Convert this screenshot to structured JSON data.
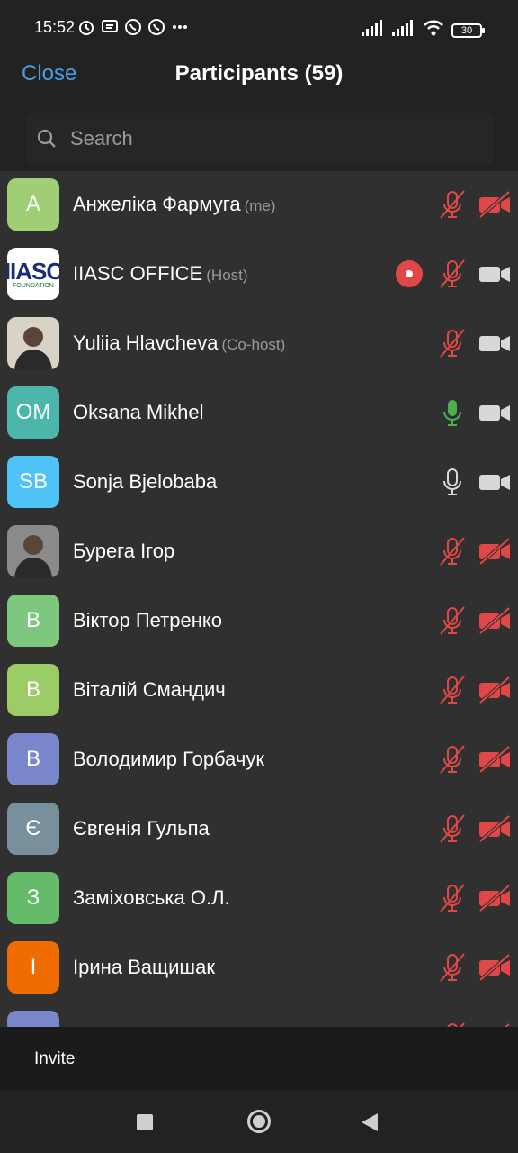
{
  "status_bar": {
    "time": "15:52",
    "battery": "30"
  },
  "header": {
    "close_label": "Close",
    "title": "Participants (59)"
  },
  "search": {
    "placeholder": "Search"
  },
  "participants": [
    {
      "initials": "A",
      "name": "Анжеліка Фармуга",
      "role": "(me)",
      "avatar_color": "#9fce74",
      "mic": "muted",
      "video": "off"
    },
    {
      "initials": "",
      "name": "IIASC OFFICE",
      "role": "(Host)",
      "avatar_color": "#ffffff",
      "avatar_logo": "IIASC",
      "avatar_logo_sub": "FOUNDATION",
      "recording": true,
      "mic": "muted",
      "video": "on"
    },
    {
      "initials": "",
      "name": "Yuliia Hlavcheva",
      "role": "(Co-host)",
      "avatar_color": "#d9d2c6",
      "avatar_photo": true,
      "mic": "muted",
      "video": "on"
    },
    {
      "initials": "OM",
      "name": "Oksana Mikhel",
      "role": "",
      "avatar_color": "#4db6ac",
      "mic": "active",
      "video": "on"
    },
    {
      "initials": "SB",
      "name": "Sonja Bjelobaba",
      "role": "",
      "avatar_color": "#4fc3f7",
      "mic": "on",
      "video": "on"
    },
    {
      "initials": "",
      "name": "Бурега Ігор",
      "role": "",
      "avatar_color": "#8a8a8a",
      "avatar_photo": true,
      "mic": "muted",
      "video": "off"
    },
    {
      "initials": "В",
      "name": "Віктор Петренко",
      "role": "",
      "avatar_color": "#7ec77f",
      "mic": "muted",
      "video": "off"
    },
    {
      "initials": "В",
      "name": "Віталій Смандич",
      "role": "",
      "avatar_color": "#9ccc65",
      "mic": "muted",
      "video": "off"
    },
    {
      "initials": "В",
      "name": "Володимир Горбачук",
      "role": "",
      "avatar_color": "#7986cb",
      "mic": "muted",
      "video": "off"
    },
    {
      "initials": "Є",
      "name": "Євгенія Гульпа",
      "role": "",
      "avatar_color": "#78909c",
      "mic": "muted",
      "video": "off"
    },
    {
      "initials": "З",
      "name": "Заміховська О.Л.",
      "role": "",
      "avatar_color": "#66bb6a",
      "mic": "muted",
      "video": "off"
    },
    {
      "initials": "І",
      "name": "Ірина Ващишак",
      "role": "",
      "avatar_color": "#ef6c00",
      "mic": "muted",
      "video": "off"
    },
    {
      "initials": "",
      "name": "",
      "role": "",
      "avatar_color": "#7986cb",
      "mic": "muted",
      "video": "off"
    }
  ],
  "footer": {
    "invite_label": "Invite"
  },
  "colors": {
    "accent": "#4a9ee8",
    "muted_red": "#e04848",
    "active_green": "#4caf50"
  }
}
